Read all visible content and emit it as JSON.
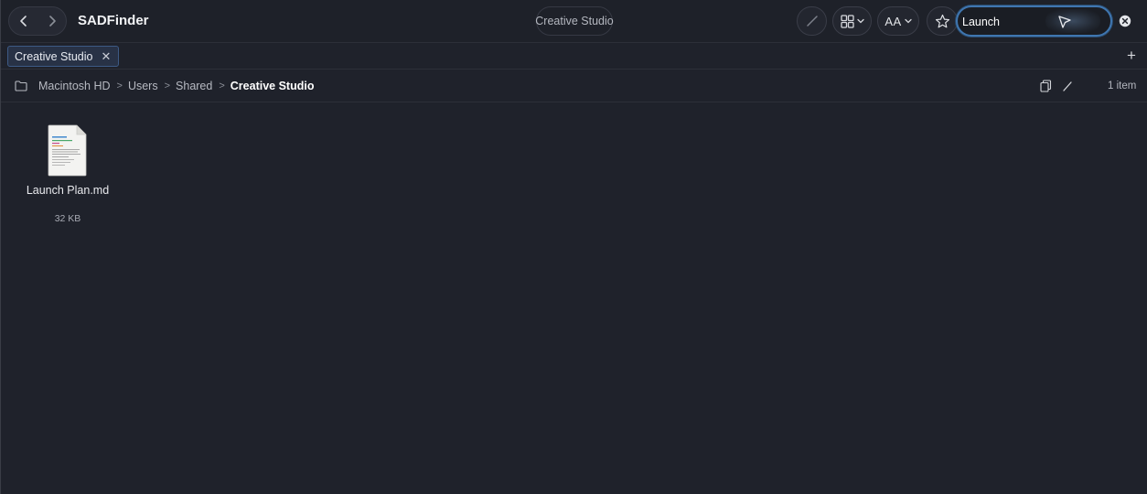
{
  "app": {
    "title": "SADFinder"
  },
  "window": {
    "title": "Creative Studio"
  },
  "toolbar": {
    "back_icon": "chevron-left-icon",
    "forward_icon": "chevron-right-icon",
    "tag_icon": "pencil-slash-icon",
    "view_icon": "grid-view-icon",
    "text_size_label": "AA",
    "favorite_icon": "star-icon"
  },
  "search": {
    "value": "Launch",
    "placeholder": "Search"
  },
  "tabs": [
    {
      "label": "Creative Studio",
      "close": "✕"
    }
  ],
  "add_tab_label": "+",
  "breadcrumb": {
    "items": [
      "Macintosh HD",
      "Users",
      "Shared"
    ],
    "current": "Creative Studio",
    "separator": ">"
  },
  "status": {
    "item_count": "1 item"
  },
  "files": [
    {
      "name": "Launch Plan.md",
      "size": "32 KB",
      "icon": "markdown-file-icon"
    }
  ],
  "colors": {
    "background": "#1f222b",
    "accent": "#3f76b0",
    "tab_bg": "#283246"
  }
}
